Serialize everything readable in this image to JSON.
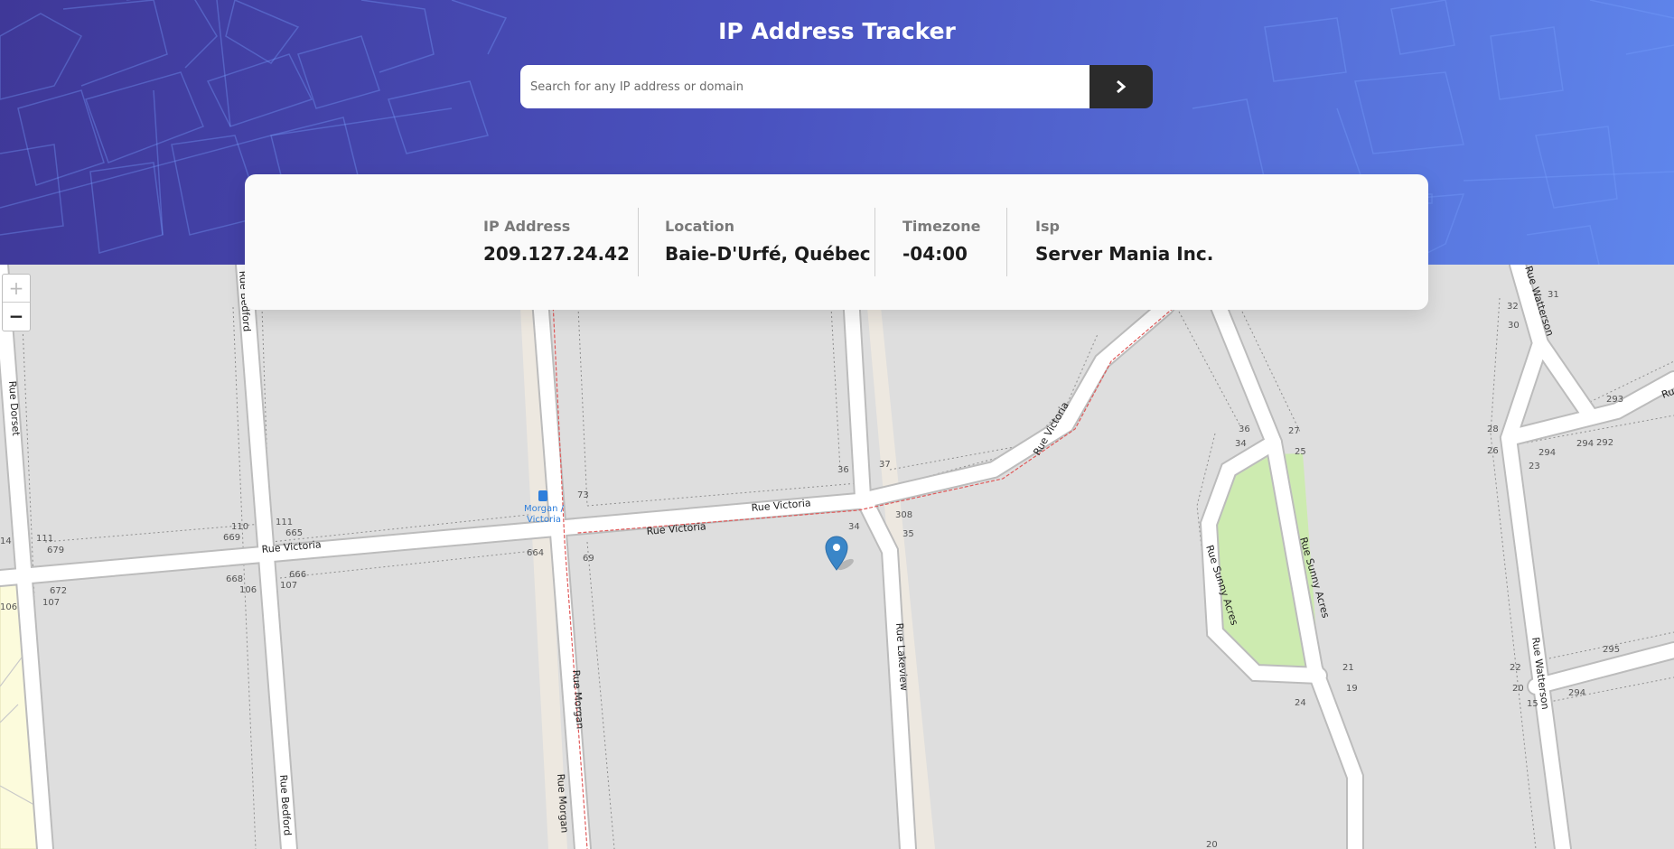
{
  "header": {
    "title": "IP Address Tracker",
    "search_placeholder": "Search for any IP address or domain",
    "search_icon": "chevron-right-icon"
  },
  "info": {
    "ip": {
      "label": "IP Address",
      "value": "209.127.24.42"
    },
    "location": {
      "label": "Location",
      "value": "Baie-D'Urfé, Québec"
    },
    "timezone": {
      "label": "Timezone",
      "value": "-04:00"
    },
    "isp": {
      "label": "Isp",
      "value": "Server Mania Inc."
    }
  },
  "map": {
    "zoom_in": "+",
    "zoom_out": "−",
    "marker_icon": "map-pin-icon",
    "streets": {
      "victoria": "Rue Victoria",
      "bedford": "Rue Bedford",
      "dorset": "Rue Dorset",
      "morgan": "Rue Morgan",
      "lakeview": "Rue Lakeview",
      "sunny_acres": "Rue Sunny Acres",
      "watterson": "Rue Watterson",
      "ru": "Ru"
    },
    "bus_stop": {
      "line1": "Morgan /",
      "line2": "Victoria"
    },
    "house_numbers": {
      "n14": "14",
      "n111a": "111",
      "n679": "679",
      "n110": "110",
      "n669": "669",
      "n111b": "111",
      "n665": "665",
      "n664": "664",
      "n666": "666",
      "n107a": "107",
      "n668": "668",
      "n106a": "106",
      "n672": "672",
      "n107b": "107",
      "n106b": "106",
      "n73": "73",
      "n69": "69",
      "n36a": "36",
      "n37": "37",
      "n308": "308",
      "n34a": "34",
      "n35": "35",
      "n36b": "36",
      "n34b": "34",
      "n27": "27",
      "n25": "25",
      "n21": "21",
      "n19": "19",
      "n24": "24",
      "n32": "32",
      "n31": "31",
      "n30": "30",
      "n293": "293",
      "n28": "28",
      "n294a": "294",
      "n292": "292",
      "n26": "26",
      "n23": "23",
      "n295": "295",
      "n22": "22",
      "n20a": "20",
      "n294b": "294",
      "n15": "15",
      "n20b": "20"
    }
  }
}
